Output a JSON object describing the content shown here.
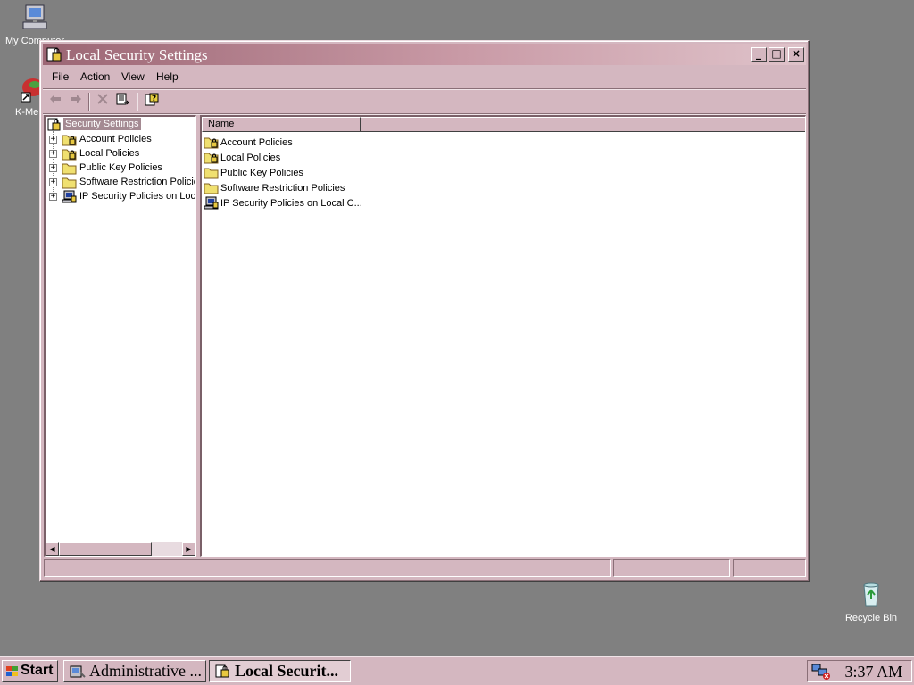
{
  "desktop": {
    "icons": [
      {
        "label": "My Computer",
        "icon": "my-computer-icon"
      },
      {
        "label": "K-Mel",
        "icon": "k-meleon-icon"
      },
      {
        "label": "Recycle Bin",
        "icon": "recycle-bin-icon"
      }
    ]
  },
  "window": {
    "title": "Local Security Settings",
    "controls": {
      "minimize": "_",
      "maximize": "□",
      "close": "×"
    },
    "menu": [
      "File",
      "Action",
      "View",
      "Help"
    ],
    "toolbar": [
      "back-arrow-icon",
      "forward-arrow-icon",
      "delete-icon",
      "export-list-icon",
      "help-icon"
    ]
  },
  "tree": {
    "root": "Security Settings",
    "items": [
      {
        "label": "Account Policies",
        "icon": "locked-folder-icon"
      },
      {
        "label": "Local Policies",
        "icon": "locked-folder-icon"
      },
      {
        "label": "Public Key Policies",
        "icon": "folder-icon"
      },
      {
        "label": "Software Restriction Policies",
        "icon": "folder-icon"
      },
      {
        "label": "IP Security Policies on Local Computer",
        "icon": "ip-security-icon"
      }
    ]
  },
  "list": {
    "column_header": "Name",
    "items": [
      {
        "label": "Account Policies",
        "icon": "locked-folder-icon"
      },
      {
        "label": "Local Policies",
        "icon": "locked-folder-icon"
      },
      {
        "label": "Public Key Policies",
        "icon": "folder-icon"
      },
      {
        "label": "Software Restriction Policies",
        "icon": "folder-icon"
      },
      {
        "label": "IP Security Policies on Local C...",
        "icon": "ip-security-icon"
      }
    ]
  },
  "taskbar": {
    "start": "Start",
    "tasks": [
      {
        "label": "Administrative ...",
        "active": false
      },
      {
        "label": "Local Securit...",
        "active": true
      }
    ],
    "clock": "3:37 AM"
  },
  "colors": {
    "chrome": "#d4b7c0",
    "title_gradient_start": "#9c6674",
    "desktop": "#808080",
    "selection": "#a48a92"
  }
}
